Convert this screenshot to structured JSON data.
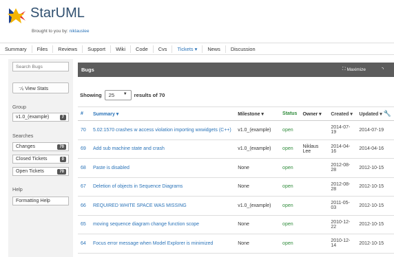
{
  "header": {
    "logo_text": "StarUML",
    "brought_prefix": "Brought to you by:",
    "brought_user": "niklauslee"
  },
  "nav": {
    "items": [
      "Summary",
      "Files",
      "Reviews",
      "Support",
      "Wiki",
      "Code",
      "Cvs",
      "Tickets ▾",
      "News",
      "Discussion"
    ],
    "active": "Tickets ▾"
  },
  "sidebar": {
    "search_placeholder": "Search Bugs",
    "view_stats": "View Stats",
    "group_label": "Group",
    "group_item": {
      "label": "v1.0_(example)",
      "count": "7"
    },
    "searches_label": "Searches",
    "searches": [
      {
        "label": "Changes",
        "count": "70"
      },
      {
        "label": "Closed Tickets",
        "count": "0"
      },
      {
        "label": "Open Tickets",
        "count": "70"
      }
    ],
    "help_label": "Help",
    "formatting_help": "Formatting Help"
  },
  "panel": {
    "title": "Bugs",
    "maximize": "Maximize"
  },
  "pager": {
    "showing_label": "Showing",
    "page_size": "25",
    "results_label": "results of 70"
  },
  "table": {
    "columns": [
      "#",
      "Summary ▾",
      "Milestone ▾",
      "Status",
      "Owner ▾",
      "Created ▾",
      "Updated ▾"
    ],
    "rows": [
      {
        "num": "70",
        "summary": "5.02:1570 crashes w access violation importing wxwidgets (C++)",
        "milestone": "v1.0_(example)",
        "status": "open",
        "owner": "",
        "created": "2014-07-19",
        "updated": "2014-07-19"
      },
      {
        "num": "69",
        "summary": "Add sub machine state and crash",
        "milestone": "v1.0_(example)",
        "status": "open",
        "owner": "Niklaus Lee",
        "created": "2014-04-16",
        "updated": "2014-04-16"
      },
      {
        "num": "68",
        "summary": "Paste is disabled",
        "milestone": "None",
        "status": "open",
        "owner": "",
        "created": "2012-08-28",
        "updated": "2012-10-15"
      },
      {
        "num": "67",
        "summary": "Deletion of objects in Sequence Diagrams",
        "milestone": "None",
        "status": "open",
        "owner": "",
        "created": "2012-08-28",
        "updated": "2012-10-15"
      },
      {
        "num": "66",
        "summary": "REQUIRED WHITE SPACE WAS MISSING",
        "milestone": "v1.0_(example)",
        "status": "open",
        "owner": "",
        "created": "2011-05-03",
        "updated": "2012-10-15"
      },
      {
        "num": "65",
        "summary": "moving sequence diagram change function scope",
        "milestone": "None",
        "status": "open",
        "owner": "",
        "created": "2010-12-22",
        "updated": "2012-10-15"
      },
      {
        "num": "64",
        "summary": "Focus error message when Model Explorer is minimized",
        "milestone": "None",
        "status": "open",
        "owner": "",
        "created": "2010-12-14",
        "updated": "2012-10-15"
      }
    ]
  },
  "colors": {
    "link": "#2a73b8",
    "open_status": "#2e8b3a",
    "panel_header": "#5c5c5c",
    "badge": "#555555"
  },
  "icons": {
    "logo": "starburst-logo-icon",
    "stats": "trend-icon",
    "maximize": "maximize-icon",
    "rss": "rss-icon",
    "column_settings": "wrench-icon"
  }
}
